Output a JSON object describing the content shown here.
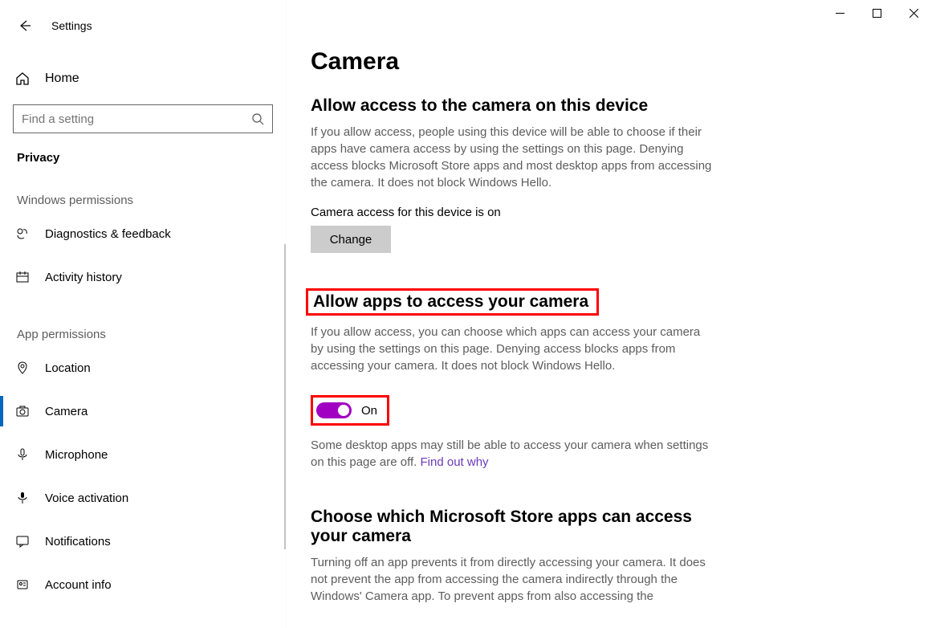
{
  "window": {
    "title": "Settings"
  },
  "sidebar": {
    "home_label": "Home",
    "search_placeholder": "Find a setting",
    "breadcrumb": "Privacy",
    "group1_header": "Windows permissions",
    "group2_header": "App permissions",
    "items_group1": [
      {
        "label": "Diagnostics & feedback"
      },
      {
        "label": "Activity history"
      }
    ],
    "items_group2": [
      {
        "label": "Location"
      },
      {
        "label": "Camera"
      },
      {
        "label": "Microphone"
      },
      {
        "label": "Voice activation"
      },
      {
        "label": "Notifications"
      },
      {
        "label": "Account info"
      }
    ]
  },
  "main": {
    "page_title": "Camera",
    "section1": {
      "heading": "Allow access to the camera on this device",
      "desc": "If you allow access, people using this device will be able to choose if their apps have camera access by using the settings on this page. Denying access blocks Microsoft Store apps and most desktop apps from accessing the camera. It does not block Windows Hello.",
      "status": "Camera access for this device is on",
      "change_label": "Change"
    },
    "section2": {
      "heading": "Allow apps to access your camera",
      "desc": "If you allow access, you can choose which apps can access your camera by using the settings on this page. Denying access blocks apps from accessing your camera. It does not block Windows Hello.",
      "toggle_state": "On",
      "note_prefix": "Some desktop apps may still be able to access your camera when settings on this page are off. ",
      "note_link": "Find out why"
    },
    "section3": {
      "heading": "Choose which Microsoft Store apps can access your camera",
      "desc": "Turning off an app prevents it from directly accessing your camera. It does not prevent the app from accessing the camera indirectly through the Windows' Camera app. To prevent apps from also accessing the"
    }
  }
}
